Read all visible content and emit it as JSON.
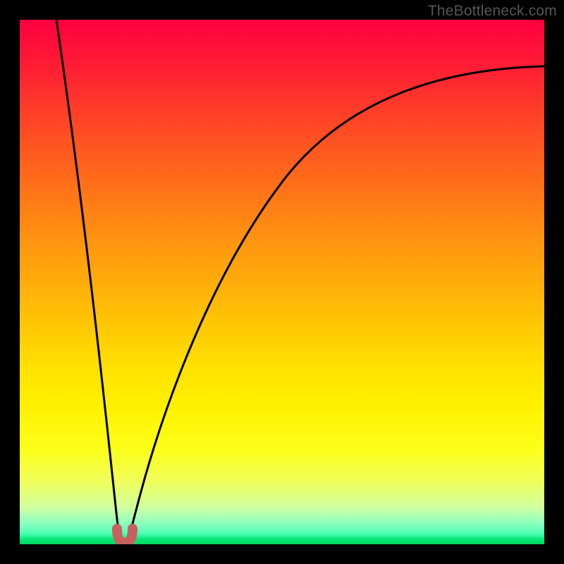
{
  "watermark": "TheBottleneck.com",
  "colors": {
    "frame": "#000000",
    "curve": "#000000",
    "marker_fill": "#c86060",
    "marker_stroke": "#b24a4a"
  },
  "chart_data": {
    "type": "line",
    "title": "",
    "xlabel": "",
    "ylabel": "",
    "xlim": [
      0,
      100
    ],
    "ylim": [
      0,
      100
    ],
    "grid": false,
    "legend": false,
    "annotations": [],
    "marker": {
      "x": 19.5,
      "y": 1,
      "shape": "u"
    },
    "series": [
      {
        "name": "left-branch",
        "x": [
          7,
          9,
          11,
          13,
          15,
          17,
          18
        ],
        "y": [
          100,
          82,
          65,
          48,
          32,
          15,
          5
        ]
      },
      {
        "name": "right-branch",
        "x": [
          21,
          23,
          26,
          30,
          35,
          41,
          48,
          56,
          65,
          75,
          86,
          100
        ],
        "y": [
          5,
          18,
          33,
          47,
          58,
          67,
          74,
          79,
          83,
          86,
          88,
          90
        ]
      }
    ]
  }
}
